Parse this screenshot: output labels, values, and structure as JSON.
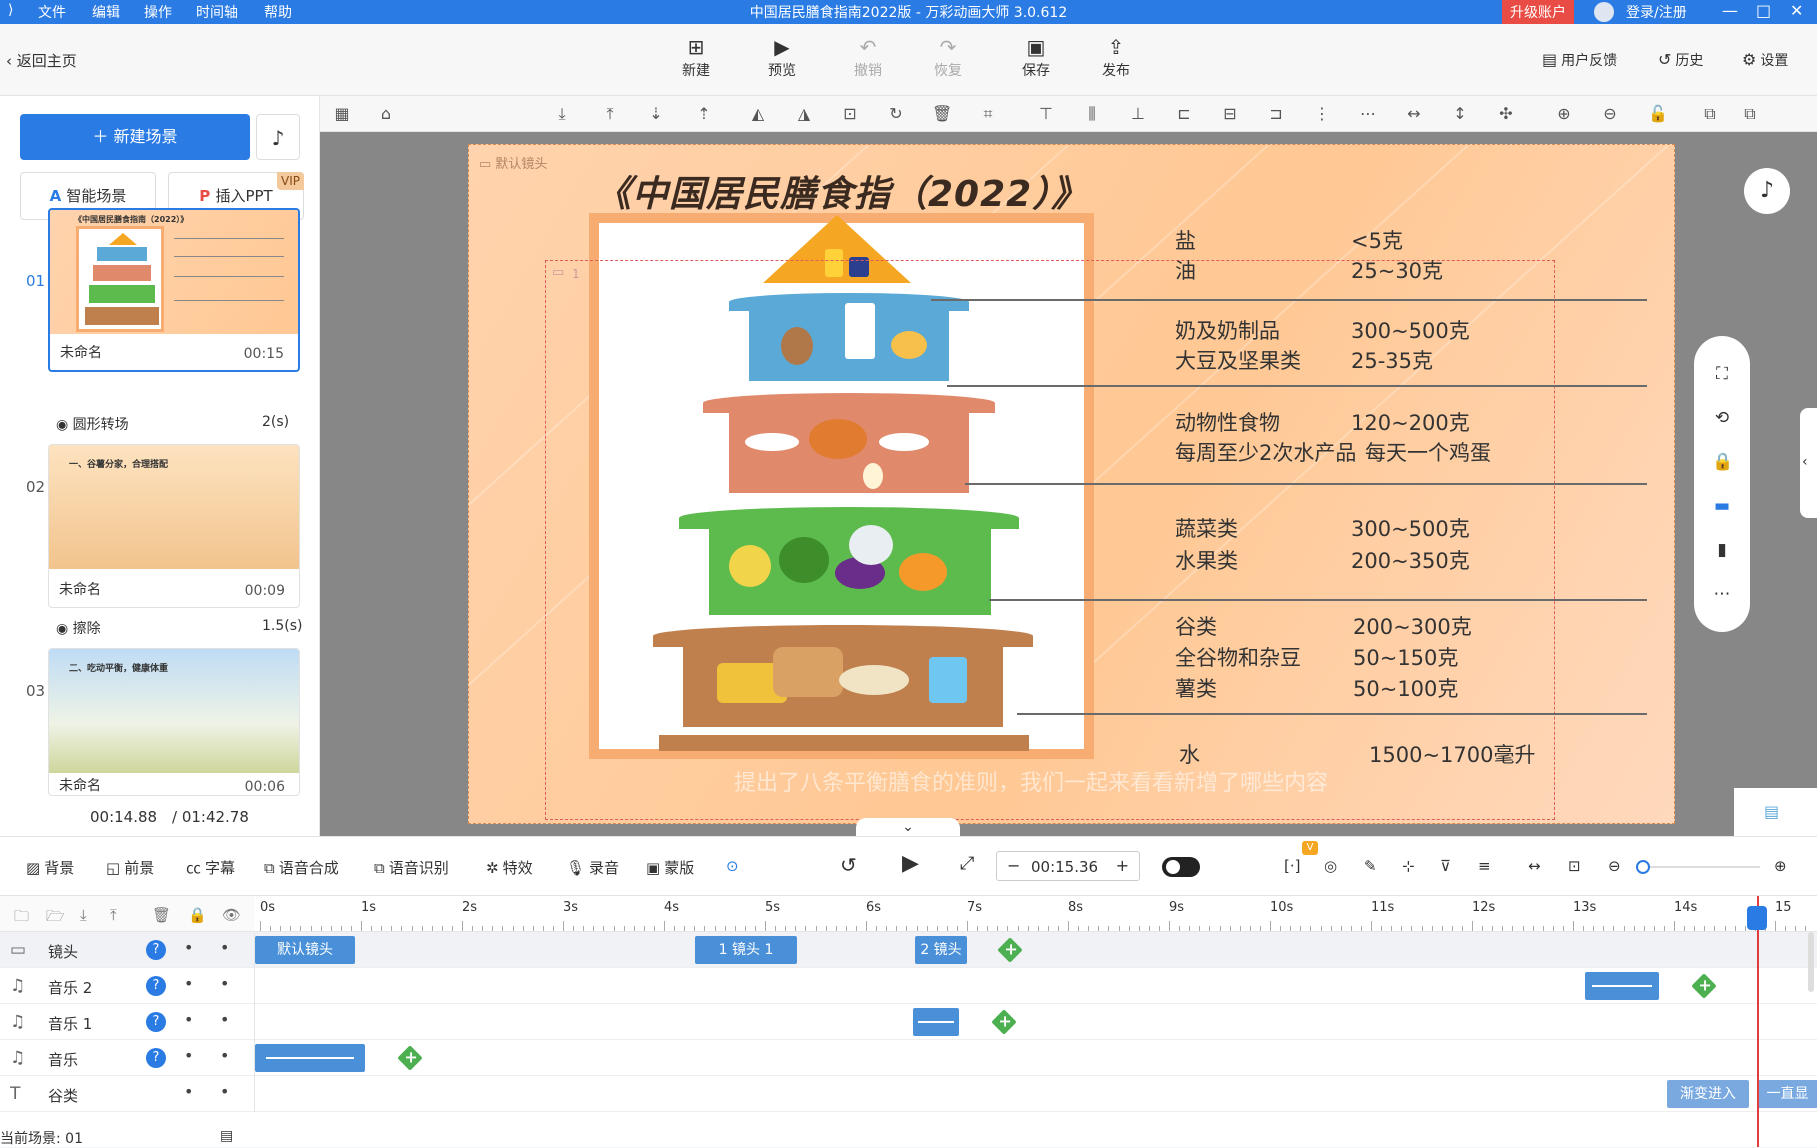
{
  "titlebar": {
    "menus": [
      "文件",
      "编辑",
      "操作",
      "时间轴",
      "帮助"
    ],
    "window_title": "中国居民膳食指南2022版 - 万彩动画大师 3.0.612",
    "upgrade": "升级账户",
    "login": "登录/注册",
    "accent": "#2a7be4"
  },
  "toolbar": {
    "back": "返回主页",
    "buttons": [
      {
        "label": "新建",
        "icon": "plus-square-icon"
      },
      {
        "label": "预览",
        "icon": "play-icon"
      },
      {
        "label": "撤销",
        "icon": "undo-icon"
      },
      {
        "label": "恢复",
        "icon": "redo-icon"
      },
      {
        "label": "保存",
        "icon": "save-icon"
      },
      {
        "label": "发布",
        "icon": "publish-icon"
      }
    ],
    "right": {
      "feedback": "用户反馈",
      "history": "历史",
      "settings": "设置"
    }
  },
  "left": {
    "new_scene": "新建场景",
    "smart_scene": "智能场景",
    "insert_ppt": "插入PPT",
    "vip": "VIP",
    "scenes": [
      {
        "num": "01",
        "name": "未命名",
        "duration": "00:15",
        "thumb_title": "《中国居民膳食指南（2022）》"
      },
      {
        "num": "02",
        "name": "未命名",
        "duration": "00:09",
        "thumb_title": "一、谷薯分家，合理搭配"
      },
      {
        "num": "03",
        "name": "未命名",
        "duration": "00:06",
        "thumb_title": "二、吃动平衡，健康体重"
      }
    ],
    "transitions": [
      {
        "name": "圆形转场",
        "duration": "2(s)"
      },
      {
        "name": "擦除",
        "duration": "1.5(s)"
      }
    ],
    "current_time": "00:14.88",
    "total_time": "/ 01:42.78"
  },
  "canvas": {
    "camera_label": "默认镜头",
    "camera1": "1",
    "title": "《中国居民膳食指（2022）》",
    "rows": [
      {
        "name": "盐",
        "value": "<5克"
      },
      {
        "name": "油",
        "value": "25~30克"
      },
      {
        "name": "奶及奶制品",
        "value": "300~500克"
      },
      {
        "name": "大豆及坚果类",
        "value": "25-35克"
      },
      {
        "name": "动物性食物",
        "value": "120~200克"
      },
      {
        "name": "每周至少2次水产品",
        "value": "每天一个鸡蛋"
      },
      {
        "name": "蔬菜类",
        "value": "300~500克"
      },
      {
        "name": "水果类",
        "value": "200~350克"
      },
      {
        "name": "谷类",
        "value": "200~300克"
      },
      {
        "name": "全谷物和杂豆",
        "value": "50~150克"
      },
      {
        "name": "薯类",
        "value": "50~100克"
      },
      {
        "name": "水",
        "value": "1500~1700毫升"
      }
    ],
    "subtitle": "提出了八条平衡膳食的准则，我们一起来看看新增了哪些内容"
  },
  "timeline_bar": {
    "items": [
      "背景",
      "前景",
      "字幕",
      "语音合成",
      "语音识别",
      "特效",
      "录音",
      "蒙版"
    ],
    "time": "00:15.36",
    "badge": "V"
  },
  "timeline": {
    "ticks": [
      "0s",
      "1s",
      "2s",
      "3s",
      "4s",
      "5s",
      "6s",
      "7s",
      "8s",
      "9s",
      "10s",
      "11s",
      "12s",
      "13s",
      "14s",
      "15"
    ],
    "tracks": [
      {
        "label": "镜头",
        "clips": [
          "默认镜头",
          "1 镜头 1",
          "2 镜头"
        ]
      },
      {
        "label": "音乐 2"
      },
      {
        "label": "音乐 1"
      },
      {
        "label": "音乐"
      },
      {
        "label": "谷类",
        "clips": [
          "渐变进入",
          "一直显"
        ]
      }
    ],
    "current_scene": "当前场景: 01"
  }
}
